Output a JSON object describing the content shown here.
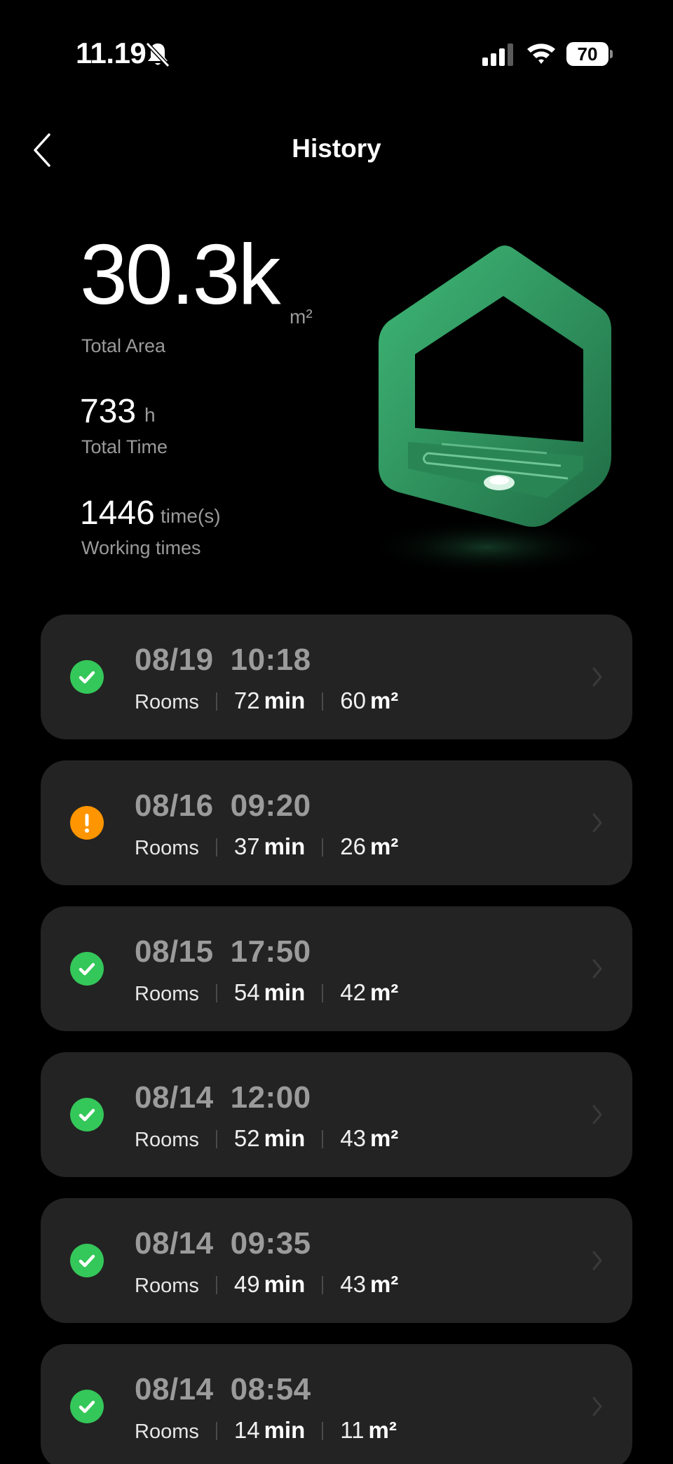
{
  "status_bar": {
    "time": "11.19",
    "battery_level": "70"
  },
  "nav": {
    "title": "History"
  },
  "stats": {
    "total_area": {
      "value": "30.3k",
      "unit": "m²",
      "label": "Total Area"
    },
    "total_time": {
      "value": "733",
      "unit": "h",
      "label": "Total Time"
    },
    "working_times": {
      "value": "1446",
      "unit": "time(s)",
      "label": "Working times"
    }
  },
  "colors": {
    "success": "#34C759",
    "warning": "#FF9500",
    "card_bg": "#232323",
    "house_green": "#2F9B63"
  },
  "records": [
    {
      "date": "08/19",
      "time": "10:18",
      "label": "Rooms",
      "duration": "72",
      "duration_unit": "min",
      "area": "60",
      "area_unit": "m²",
      "status": "success"
    },
    {
      "date": "08/16",
      "time": "09:20",
      "label": "Rooms",
      "duration": "37",
      "duration_unit": "min",
      "area": "26",
      "area_unit": "m²",
      "status": "warning"
    },
    {
      "date": "08/15",
      "time": "17:50",
      "label": "Rooms",
      "duration": "54",
      "duration_unit": "min",
      "area": "42",
      "area_unit": "m²",
      "status": "success"
    },
    {
      "date": "08/14",
      "time": "12:00",
      "label": "Rooms",
      "duration": "52",
      "duration_unit": "min",
      "area": "43",
      "area_unit": "m²",
      "status": "success"
    },
    {
      "date": "08/14",
      "time": "09:35",
      "label": "Rooms",
      "duration": "49",
      "duration_unit": "min",
      "area": "43",
      "area_unit": "m²",
      "status": "success"
    },
    {
      "date": "08/14",
      "time": "08:54",
      "label": "Rooms",
      "duration": "14",
      "duration_unit": "min",
      "area": "11",
      "area_unit": "m²",
      "status": "success"
    }
  ]
}
